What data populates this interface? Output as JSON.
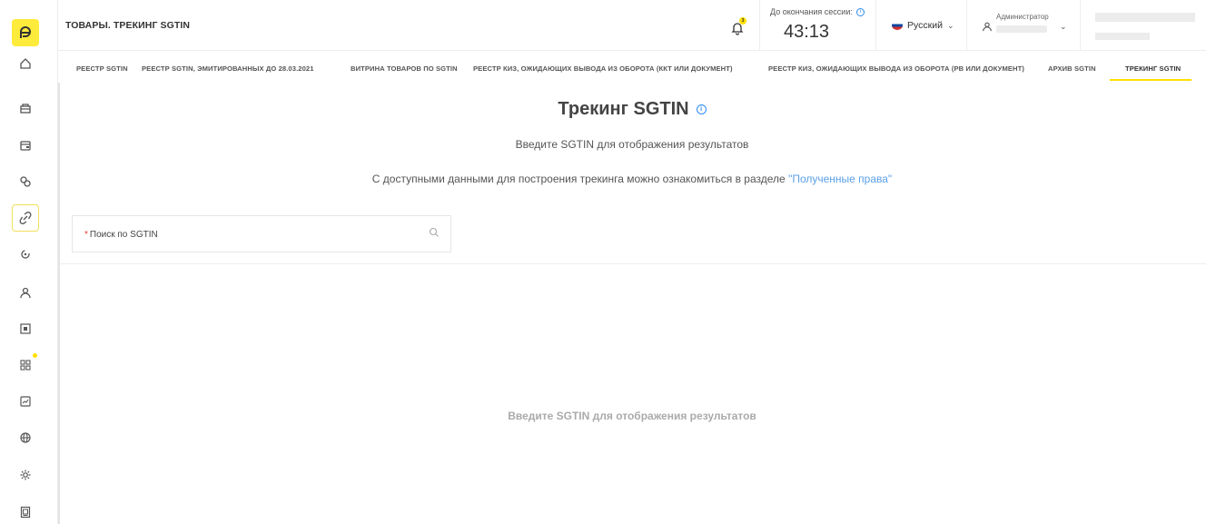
{
  "header": {
    "title": "ТОВАРЫ. ТРЕКИНГ SGTIN",
    "notification_count": "3",
    "session_label": "До окончания сессии:",
    "session_time": "43:13",
    "language": "Русский",
    "user_role": "Администратор"
  },
  "tabs": [
    {
      "label": "РЕЕСТР SGTIN"
    },
    {
      "label": "РЕЕСТР SGTIN, ЭМИТИРОВАННЫХ ДО 28.03.2021"
    },
    {
      "label": "ВИТРИНА ТОВАРОВ ПО SGTIN"
    },
    {
      "label": "РЕЕСТР КИЗ, ОЖИДАЮЩИХ ВЫВОДА ИЗ ОБОРОТА (ККТ ИЛИ ДОКУМЕНТ)"
    },
    {
      "label": "РЕЕСТР КИЗ, ОЖИДАЮЩИХ ВЫВОДА ИЗ ОБОРОТА (РВ ИЛИ ДОКУМЕНТ)"
    },
    {
      "label": "АРХИВ SGTIN"
    },
    {
      "label": "ТРЕКИНГ SGTIN"
    }
  ],
  "active_tab": "ТРЕКИНГ SGTIN",
  "main": {
    "heading": "Трекинг SGTIN",
    "subtitle": "Введите SGTIN для отображения результатов",
    "rights_text": "С доступными данными для построения трекинга можно ознакомиться в разделе",
    "rights_link": "\"Полученные права\"",
    "search_placeholder": "Поиск по SGTIN",
    "required_mark": "*",
    "empty_message": "Введите SGTIN для отображения результатов"
  },
  "colors": {
    "accent": "#ffe000",
    "link": "#5aa0e6",
    "required": "#e53935"
  },
  "sidebar_icons": [
    "home-icon",
    "box-icon",
    "wallet-icon",
    "pills-icon",
    "link-icon",
    "scan-icon",
    "user-icon",
    "qr-code-icon",
    "apps-icon",
    "chart-icon",
    "globe-icon",
    "gear-icon",
    "document-icon"
  ]
}
